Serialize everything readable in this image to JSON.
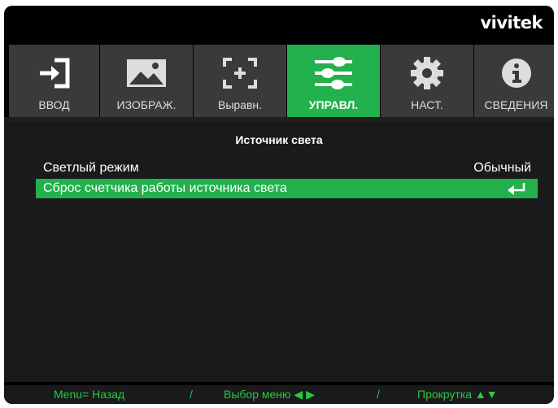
{
  "brand": "vivitek",
  "tabs": [
    {
      "label": "ВВОД",
      "icon": "input-icon"
    },
    {
      "label": "ИЗОБРАЖ.",
      "icon": "image-icon"
    },
    {
      "label": "Выравн.",
      "icon": "alignment-icon"
    },
    {
      "label": "УПРАВЛ.",
      "icon": "sliders-icon",
      "active": true
    },
    {
      "label": "НАСТ.",
      "icon": "gear-icon"
    },
    {
      "label": "СВЕДЕНИЯ",
      "icon": "info-icon"
    }
  ],
  "menu": {
    "title": "Источник света",
    "rows": [
      {
        "label": "Светлый режим",
        "value": "Обычный"
      },
      {
        "label": "Сброс счетчика работы источника света",
        "value_icon": "enter-icon",
        "selected": true
      }
    ]
  },
  "footer": {
    "back": "Menu= Назад",
    "sep1": "/",
    "select": "Выбор меню ◀ ▶",
    "sep2": "/",
    "scroll": "Прокрутка ▲▼"
  },
  "colors": {
    "accent": "#22b14c",
    "tab_bg": "#3a3a3a",
    "hint_text": "#22cc44"
  }
}
